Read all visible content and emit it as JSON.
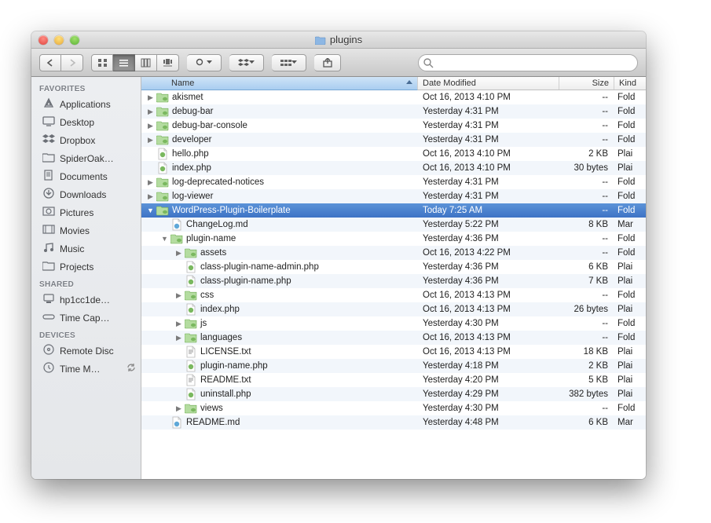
{
  "window": {
    "title": "plugins"
  },
  "search": {
    "placeholder": ""
  },
  "columns": {
    "name": "Name",
    "date": "Date Modified",
    "size": "Size",
    "kind": "Kind"
  },
  "sidebar": {
    "sections": [
      {
        "label": "FAVORITES",
        "items": [
          {
            "icon": "applications",
            "label": "Applications"
          },
          {
            "icon": "desktop",
            "label": "Desktop"
          },
          {
            "icon": "dropbox",
            "label": "Dropbox"
          },
          {
            "icon": "folder",
            "label": "SpiderOak…"
          },
          {
            "icon": "documents",
            "label": "Documents"
          },
          {
            "icon": "downloads",
            "label": "Downloads"
          },
          {
            "icon": "pictures",
            "label": "Pictures"
          },
          {
            "icon": "movies",
            "label": "Movies"
          },
          {
            "icon": "music",
            "label": "Music"
          },
          {
            "icon": "folder",
            "label": "Projects"
          }
        ]
      },
      {
        "label": "SHARED",
        "items": [
          {
            "icon": "computer",
            "label": "hp1cc1de…"
          },
          {
            "icon": "timecapsule",
            "label": "Time Cap…"
          }
        ]
      },
      {
        "label": "DEVICES",
        "items": [
          {
            "icon": "disc",
            "label": "Remote Disc"
          },
          {
            "icon": "timemachine",
            "label": "Time M…",
            "sync": true
          }
        ]
      }
    ]
  },
  "files": [
    {
      "indent": 0,
      "disclosure": "closed",
      "icon": "folder-green",
      "name": "akismet",
      "date": "Oct 16, 2013 4:10 PM",
      "size": "--",
      "kind": "Fold"
    },
    {
      "indent": 0,
      "disclosure": "closed",
      "icon": "folder-green",
      "name": "debug-bar",
      "date": "Yesterday 4:31 PM",
      "size": "--",
      "kind": "Fold"
    },
    {
      "indent": 0,
      "disclosure": "closed",
      "icon": "folder-green",
      "name": "debug-bar-console",
      "date": "Yesterday 4:31 PM",
      "size": "--",
      "kind": "Fold"
    },
    {
      "indent": 0,
      "disclosure": "closed",
      "icon": "folder-green",
      "name": "developer",
      "date": "Yesterday 4:31 PM",
      "size": "--",
      "kind": "Fold"
    },
    {
      "indent": 0,
      "disclosure": "none",
      "icon": "php",
      "name": "hello.php",
      "date": "Oct 16, 2013 4:10 PM",
      "size": "2 KB",
      "kind": "Plai"
    },
    {
      "indent": 0,
      "disclosure": "none",
      "icon": "php",
      "name": "index.php",
      "date": "Oct 16, 2013 4:10 PM",
      "size": "30 bytes",
      "kind": "Plai"
    },
    {
      "indent": 0,
      "disclosure": "closed",
      "icon": "folder-green",
      "name": "log-deprecated-notices",
      "date": "Yesterday 4:31 PM",
      "size": "--",
      "kind": "Fold"
    },
    {
      "indent": 0,
      "disclosure": "closed",
      "icon": "folder-green",
      "name": "log-viewer",
      "date": "Yesterday 4:31 PM",
      "size": "--",
      "kind": "Fold"
    },
    {
      "indent": 0,
      "disclosure": "open",
      "icon": "folder-green",
      "name": "WordPress-Plugin-Boilerplate",
      "date": "Today 7:25 AM",
      "size": "--",
      "kind": "Fold",
      "selected": true
    },
    {
      "indent": 1,
      "disclosure": "none",
      "icon": "md",
      "name": "ChangeLog.md",
      "date": "Yesterday 5:22 PM",
      "size": "8 KB",
      "kind": "Mar"
    },
    {
      "indent": 1,
      "disclosure": "open",
      "icon": "folder-green",
      "name": "plugin-name",
      "date": "Yesterday 4:36 PM",
      "size": "--",
      "kind": "Fold"
    },
    {
      "indent": 2,
      "disclosure": "closed",
      "icon": "folder-green",
      "name": "assets",
      "date": "Oct 16, 2013 4:22 PM",
      "size": "--",
      "kind": "Fold"
    },
    {
      "indent": 2,
      "disclosure": "none",
      "icon": "php",
      "name": "class-plugin-name-admin.php",
      "date": "Yesterday 4:36 PM",
      "size": "6 KB",
      "kind": "Plai"
    },
    {
      "indent": 2,
      "disclosure": "none",
      "icon": "php",
      "name": "class-plugin-name.php",
      "date": "Yesterday 4:36 PM",
      "size": "7 KB",
      "kind": "Plai"
    },
    {
      "indent": 2,
      "disclosure": "closed",
      "icon": "folder-green",
      "name": "css",
      "date": "Oct 16, 2013 4:13 PM",
      "size": "--",
      "kind": "Fold"
    },
    {
      "indent": 2,
      "disclosure": "none",
      "icon": "php",
      "name": "index.php",
      "date": "Oct 16, 2013 4:13 PM",
      "size": "26 bytes",
      "kind": "Plai"
    },
    {
      "indent": 2,
      "disclosure": "closed",
      "icon": "folder-green",
      "name": "js",
      "date": "Yesterday 4:30 PM",
      "size": "--",
      "kind": "Fold"
    },
    {
      "indent": 2,
      "disclosure": "closed",
      "icon": "folder-green",
      "name": "languages",
      "date": "Oct 16, 2013 4:13 PM",
      "size": "--",
      "kind": "Fold"
    },
    {
      "indent": 2,
      "disclosure": "none",
      "icon": "txt",
      "name": "LICENSE.txt",
      "date": "Oct 16, 2013 4:13 PM",
      "size": "18 KB",
      "kind": "Plai"
    },
    {
      "indent": 2,
      "disclosure": "none",
      "icon": "php",
      "name": "plugin-name.php",
      "date": "Yesterday 4:18 PM",
      "size": "2 KB",
      "kind": "Plai"
    },
    {
      "indent": 2,
      "disclosure": "none",
      "icon": "txt",
      "name": "README.txt",
      "date": "Yesterday 4:20 PM",
      "size": "5 KB",
      "kind": "Plai"
    },
    {
      "indent": 2,
      "disclosure": "none",
      "icon": "php",
      "name": "uninstall.php",
      "date": "Yesterday 4:29 PM",
      "size": "382 bytes",
      "kind": "Plai"
    },
    {
      "indent": 2,
      "disclosure": "closed",
      "icon": "folder-green",
      "name": "views",
      "date": "Yesterday 4:30 PM",
      "size": "--",
      "kind": "Fold"
    },
    {
      "indent": 1,
      "disclosure": "none",
      "icon": "md",
      "name": "README.md",
      "date": "Yesterday 4:48 PM",
      "size": "6 KB",
      "kind": "Mar"
    }
  ]
}
